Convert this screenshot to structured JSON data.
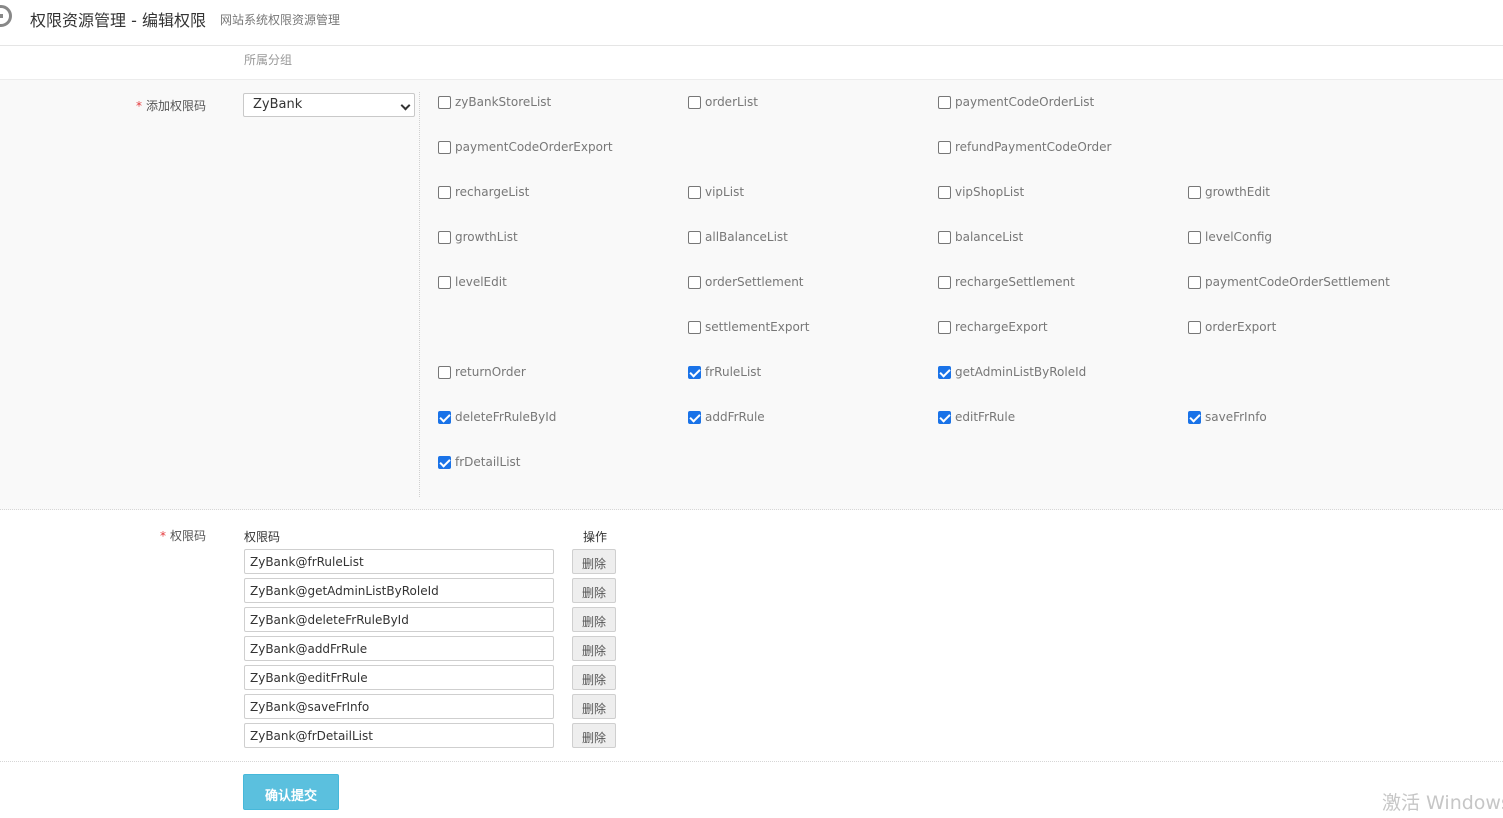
{
  "header": {
    "title": "权限资源管理 - 编辑权限",
    "subtitle": "网站系统权限资源管理"
  },
  "group_label": "所属分组",
  "add_code": {
    "label": "添加权限码",
    "required_mark": "*",
    "select_value": "ZyBank",
    "checkboxes": [
      {
        "label": "zyBankStoreList",
        "checked": false
      },
      {
        "label": "orderList",
        "checked": false
      },
      {
        "label": "paymentCodeOrderList",
        "checked": false
      },
      {
        "label": "paymentCodeOrderExport",
        "checked": false
      },
      {
        "label": "refundPaymentCodeOrder",
        "checked": false
      },
      {
        "label": "rechargeList",
        "checked": false
      },
      {
        "label": "vipList",
        "checked": false
      },
      {
        "label": "vipShopList",
        "checked": false
      },
      {
        "label": "growthEdit",
        "checked": false
      },
      {
        "label": "growthList",
        "checked": false
      },
      {
        "label": "allBalanceList",
        "checked": false
      },
      {
        "label": "balanceList",
        "checked": false
      },
      {
        "label": "levelConfig",
        "checked": false
      },
      {
        "label": "levelEdit",
        "checked": false
      },
      {
        "label": "orderSettlement",
        "checked": false
      },
      {
        "label": "rechargeSettlement",
        "checked": false
      },
      {
        "label": "paymentCodeOrderSettlement",
        "checked": false
      },
      {
        "label": "settlementExport",
        "checked": false
      },
      {
        "label": "rechargeExport",
        "checked": false
      },
      {
        "label": "orderExport",
        "checked": false
      },
      {
        "label": "returnOrder",
        "checked": false
      },
      {
        "label": "frRuleList",
        "checked": true
      },
      {
        "label": "getAdminListByRoleId",
        "checked": true
      },
      {
        "label": "deleteFrRuleById",
        "checked": true
      },
      {
        "label": "addFrRule",
        "checked": true
      },
      {
        "label": "editFrRule",
        "checked": true
      },
      {
        "label": "saveFrInfo",
        "checked": true
      },
      {
        "label": "frDetailList",
        "checked": true
      }
    ]
  },
  "codes": {
    "label": "权限码",
    "required_mark": "*",
    "col_code": "权限码",
    "col_action": "操作",
    "delete_label": "删除",
    "rows": [
      "ZyBank@frRuleList",
      "ZyBank@getAdminListByRoleId",
      "ZyBank@deleteFrRuleById",
      "ZyBank@addFrRule",
      "ZyBank@editFrRule",
      "ZyBank@saveFrInfo",
      "ZyBank@frDetailList"
    ]
  },
  "submit_label": "确认提交",
  "watermark": "激活 Windows"
}
